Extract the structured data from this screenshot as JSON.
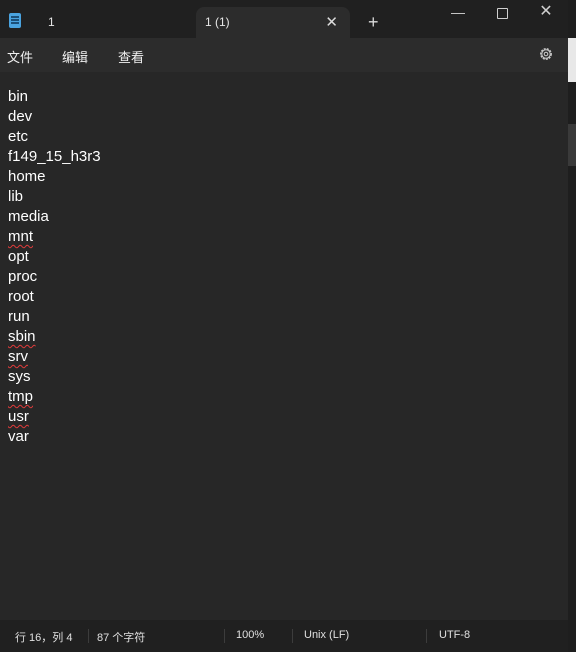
{
  "tabs": [
    {
      "label": "1",
      "active": false
    },
    {
      "label": "1 (1)",
      "active": true
    }
  ],
  "tab_close_glyph": "✕",
  "new_tab_glyph": "+",
  "window_controls": {
    "minimize_glyph": "—",
    "close_glyph": "✕"
  },
  "menu": {
    "file": "文件",
    "edit": "编辑",
    "view": "查看"
  },
  "icons": {
    "app": "notepad-icon",
    "settings": "gear-icon"
  },
  "editor": {
    "lines": [
      {
        "text": "bin",
        "misspelled": false
      },
      {
        "text": "dev",
        "misspelled": false
      },
      {
        "text": "etc",
        "misspelled": false
      },
      {
        "text": "f149_15_h3r3",
        "misspelled": false
      },
      {
        "text": "home",
        "misspelled": false
      },
      {
        "text": "lib",
        "misspelled": false
      },
      {
        "text": "media",
        "misspelled": false
      },
      {
        "text": "mnt",
        "misspelled": true
      },
      {
        "text": "opt",
        "misspelled": false
      },
      {
        "text": "proc",
        "misspelled": false
      },
      {
        "text": "root",
        "misspelled": false
      },
      {
        "text": "run",
        "misspelled": false
      },
      {
        "text": "sbin",
        "misspelled": true
      },
      {
        "text": "srv",
        "misspelled": true
      },
      {
        "text": "sys",
        "misspelled": false
      },
      {
        "text": "tmp",
        "misspelled": true
      },
      {
        "text": "usr",
        "misspelled": true
      },
      {
        "text": "var",
        "misspelled": false
      }
    ]
  },
  "status": {
    "position": "行 16，列 4",
    "char_count": "87 个字符",
    "zoom": "100%",
    "line_ending": "Unix (LF)",
    "encoding": "UTF-8"
  },
  "colors": {
    "background": "#272727",
    "titlebar": "#202020",
    "text": "#ffffff",
    "spellcheck": "#e03b3b",
    "app_icon": "#4aa3df"
  }
}
